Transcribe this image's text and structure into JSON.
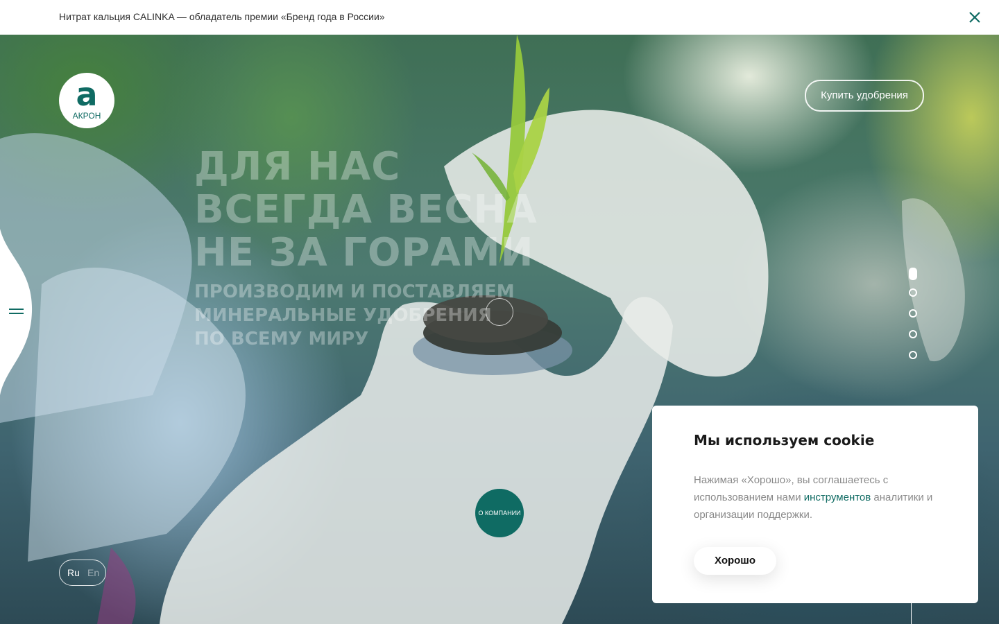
{
  "announcement": {
    "text": "Нитрат кальция CALINKA — обладатель премии «Бренд года в России»",
    "close_icon": "close-icon"
  },
  "header": {
    "logo_letter": "a",
    "logo_text": "АКРОН",
    "buy_button_label": "Купить удобрения",
    "menu_icon": "hamburger-icon"
  },
  "hero": {
    "headline": [
      "ДЛЯ НАС",
      "ВСЕГДА ВЕСНА",
      "НЕ ЗА ГОРАМИ"
    ],
    "subheadline": [
      "ПРОИЗВОДИМ И ПОСТАВЛЯЕМ",
      "МИНЕРАЛЬНЫЕ УДОБРЕНИЯ",
      "ПО ВСЕМУ МИРУ"
    ],
    "about_button_label": "О КОМПАНИИ"
  },
  "slider": {
    "count": 5,
    "active_index": 0
  },
  "language": {
    "options": [
      "Ru",
      "En"
    ],
    "selected": "Ru"
  },
  "cookie": {
    "title": "Мы используем cookie",
    "text_before_link": "Нажимая «Хорошо», вы соглашаетесь с использованием нами ",
    "link_text": "инструментов",
    "text_after_link": " аналитики и организации поддержки.",
    "ok_label": "Хорошо"
  },
  "colors": {
    "brand": "#0f6b63",
    "white": "#ffffff"
  }
}
